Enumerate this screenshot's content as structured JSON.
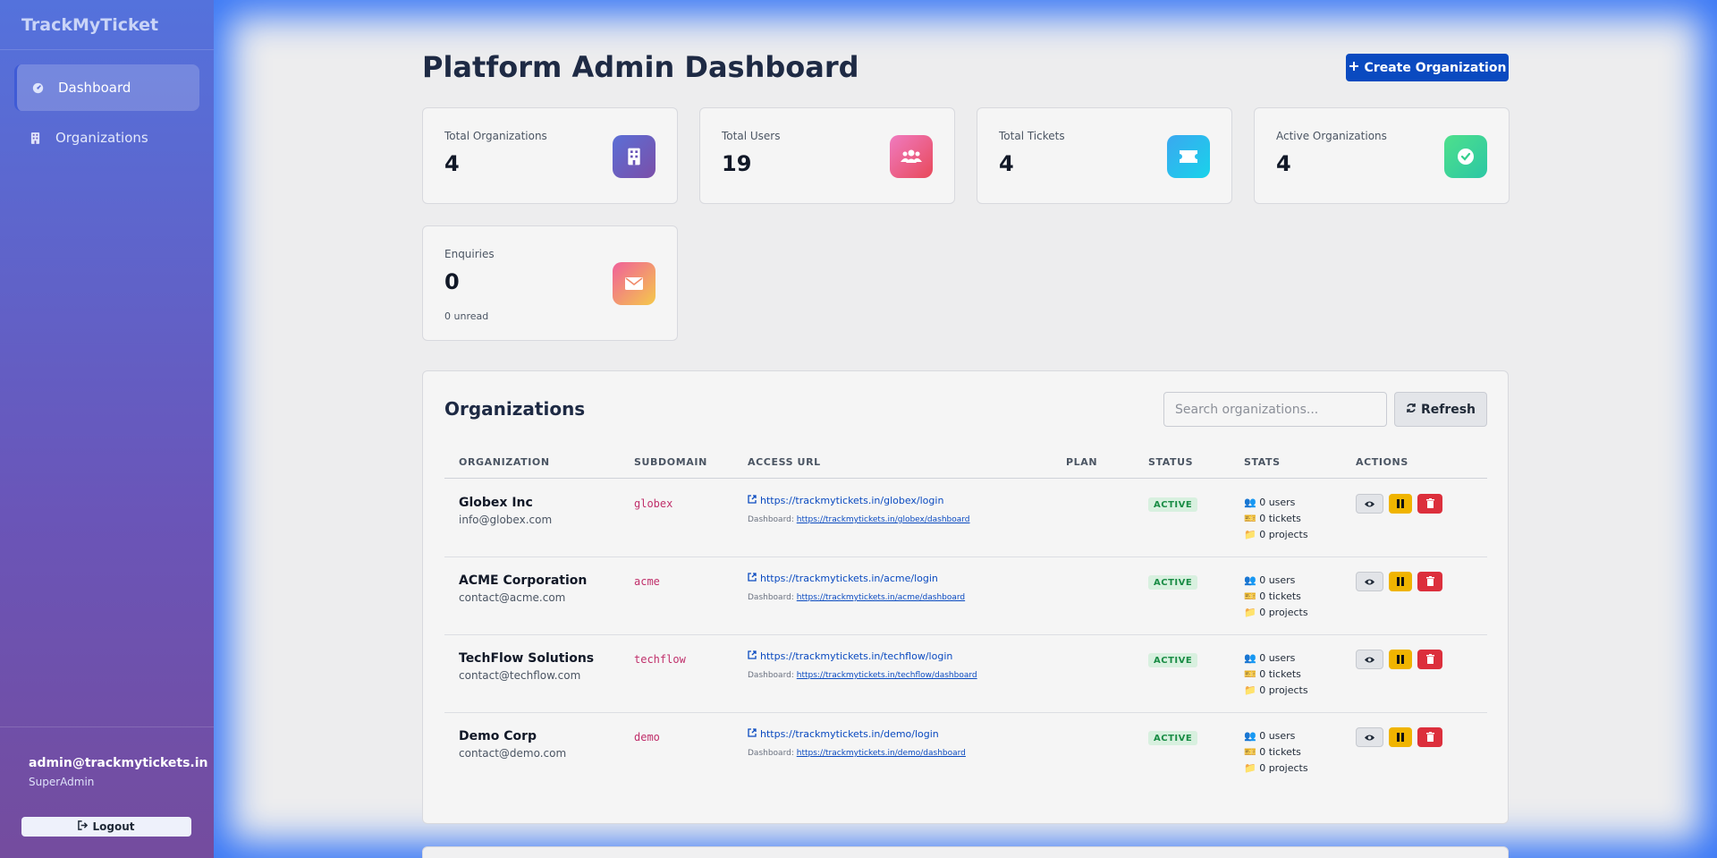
{
  "app": {
    "brand": "TrackMyTicket"
  },
  "sidebar": {
    "items": [
      {
        "label": "Dashboard",
        "icon": "gauge-icon",
        "active": true
      },
      {
        "label": "Organizations",
        "icon": "building-icon",
        "active": false
      }
    ],
    "user": {
      "email": "admin@trackmytickets.in",
      "role": "SuperAdmin",
      "logout_label": "Logout"
    }
  },
  "header": {
    "title": "Platform Admin Dashboard",
    "create_label": "Create Organization"
  },
  "stats": [
    {
      "label": "Total Organizations",
      "value": "4",
      "icon": "building-icon",
      "color": "#6a55b8"
    },
    {
      "label": "Total Users",
      "value": "19",
      "icon": "users-icon",
      "color": "#e85a8a"
    },
    {
      "label": "Total Tickets",
      "value": "4",
      "icon": "ticket-icon",
      "color": "#22c3e6"
    },
    {
      "label": "Active Organizations",
      "value": "4",
      "icon": "check-circle-icon",
      "color": "#3ad27e"
    },
    {
      "label": "Enquiries",
      "value": "0",
      "sub": "0 unread",
      "icon": "envelope-icon",
      "color": "#f08a6a"
    }
  ],
  "orgs_panel": {
    "title": "Organizations",
    "search_placeholder": "Search organizations...",
    "refresh_label": "Refresh",
    "columns": [
      "ORGANIZATION",
      "SUBDOMAIN",
      "ACCESS URL",
      "PLAN",
      "STATUS",
      "STATS",
      "ACTIONS"
    ],
    "dashboard_prefix": "Dashboard:",
    "rows": [
      {
        "name": "Globex Inc",
        "email": "info@globex.com",
        "subdomain": "globex",
        "access_url": "https://trackmytickets.in/globex/login",
        "dashboard_url": "https://trackmytickets.in/globex/dashboard",
        "plan": "",
        "status": "ACTIVE",
        "users": "👥 0 users",
        "tickets": "🎫 0 tickets",
        "projects": "📁 0 projects"
      },
      {
        "name": "ACME Corporation",
        "email": "contact@acme.com",
        "subdomain": "acme",
        "access_url": "https://trackmytickets.in/acme/login",
        "dashboard_url": "https://trackmytickets.in/acme/dashboard",
        "plan": "",
        "status": "ACTIVE",
        "users": "👥 0 users",
        "tickets": "🎫 0 tickets",
        "projects": "📁 0 projects"
      },
      {
        "name": "TechFlow Solutions",
        "email": "contact@techflow.com",
        "subdomain": "techflow",
        "access_url": "https://trackmytickets.in/techflow/login",
        "dashboard_url": "https://trackmytickets.in/techflow/dashboard",
        "plan": "",
        "status": "ACTIVE",
        "users": "👥 0 users",
        "tickets": "🎫 0 tickets",
        "projects": "📁 0 projects"
      },
      {
        "name": "Demo Corp",
        "email": "contact@demo.com",
        "subdomain": "demo",
        "access_url": "https://trackmytickets.in/demo/login",
        "dashboard_url": "https://trackmytickets.in/demo/dashboard",
        "plan": "",
        "status": "ACTIVE",
        "users": "👥 0 users",
        "tickets": "🎫 0 tickets",
        "projects": "📁 0 projects"
      }
    ]
  }
}
